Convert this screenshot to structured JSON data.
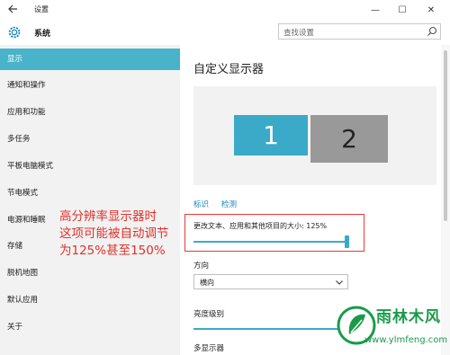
{
  "window": {
    "title": "设置",
    "controls": {
      "minimize": "—",
      "maximize": "☐",
      "close": "✕"
    }
  },
  "header": {
    "app_title": "系统",
    "search_placeholder": "查找设置"
  },
  "sidebar": {
    "items": [
      {
        "label": "显示",
        "active": true
      },
      {
        "label": "通知和操作",
        "active": false
      },
      {
        "label": "应用和功能",
        "active": false
      },
      {
        "label": "多任务",
        "active": false
      },
      {
        "label": "平板电脑模式",
        "active": false
      },
      {
        "label": "节电模式",
        "active": false
      },
      {
        "label": "电源和睡眠",
        "active": false
      },
      {
        "label": "存储",
        "active": false
      },
      {
        "label": "脱机地图",
        "active": false
      },
      {
        "label": "默认应用",
        "active": false
      },
      {
        "label": "关于",
        "active": false
      }
    ]
  },
  "annotation": {
    "line1": "高分辨率显示器时",
    "line2": "这项可能被自动调节",
    "line3": "为125%甚至150%"
  },
  "main": {
    "title": "自定义显示器",
    "monitors": [
      "1",
      "2"
    ],
    "identify_link": "标识",
    "detect_link": "检测",
    "scale_label": "更改文本、应用和其他项目的大小: 125%",
    "scale_slider_fraction": 1.0,
    "orientation_label": "方向",
    "orientation_value": "横向",
    "brightness_label": "亮度级别",
    "brightness_fraction": 1.0,
    "multi_display_label": "多显示器"
  },
  "watermark": {
    "name": "雨林木风",
    "url": "www.ylmfeng.com"
  },
  "colors": {
    "accent": "#48b3c9",
    "annotation_red": "#e0312c",
    "watermark_green": "#1a9a4a"
  }
}
